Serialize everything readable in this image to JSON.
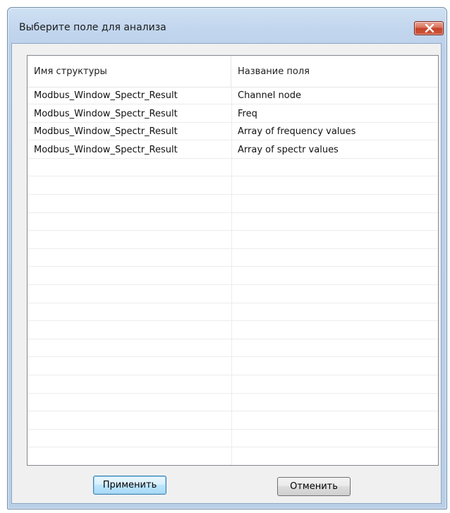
{
  "window": {
    "title": "Выберите поле для анализа"
  },
  "list": {
    "columns": [
      "Имя структуры",
      "Название поля"
    ],
    "rows": [
      [
        "Modbus_Window_Spectr_Result",
        "Channel node"
      ],
      [
        "Modbus_Window_Spectr_Result",
        "Freq"
      ],
      [
        "Modbus_Window_Spectr_Result",
        "Array of frequency values"
      ],
      [
        "Modbus_Window_Spectr_Result",
        "Array of spectr values"
      ]
    ]
  },
  "buttons": {
    "apply_label": "Применить",
    "cancel_label": "Отменить"
  },
  "colors": {
    "title_gradient_top": "#cfe0f2",
    "close_button_red": "#c4432a",
    "default_button_blue": "#3c7fb1"
  },
  "icons": {
    "close": "close-icon"
  }
}
